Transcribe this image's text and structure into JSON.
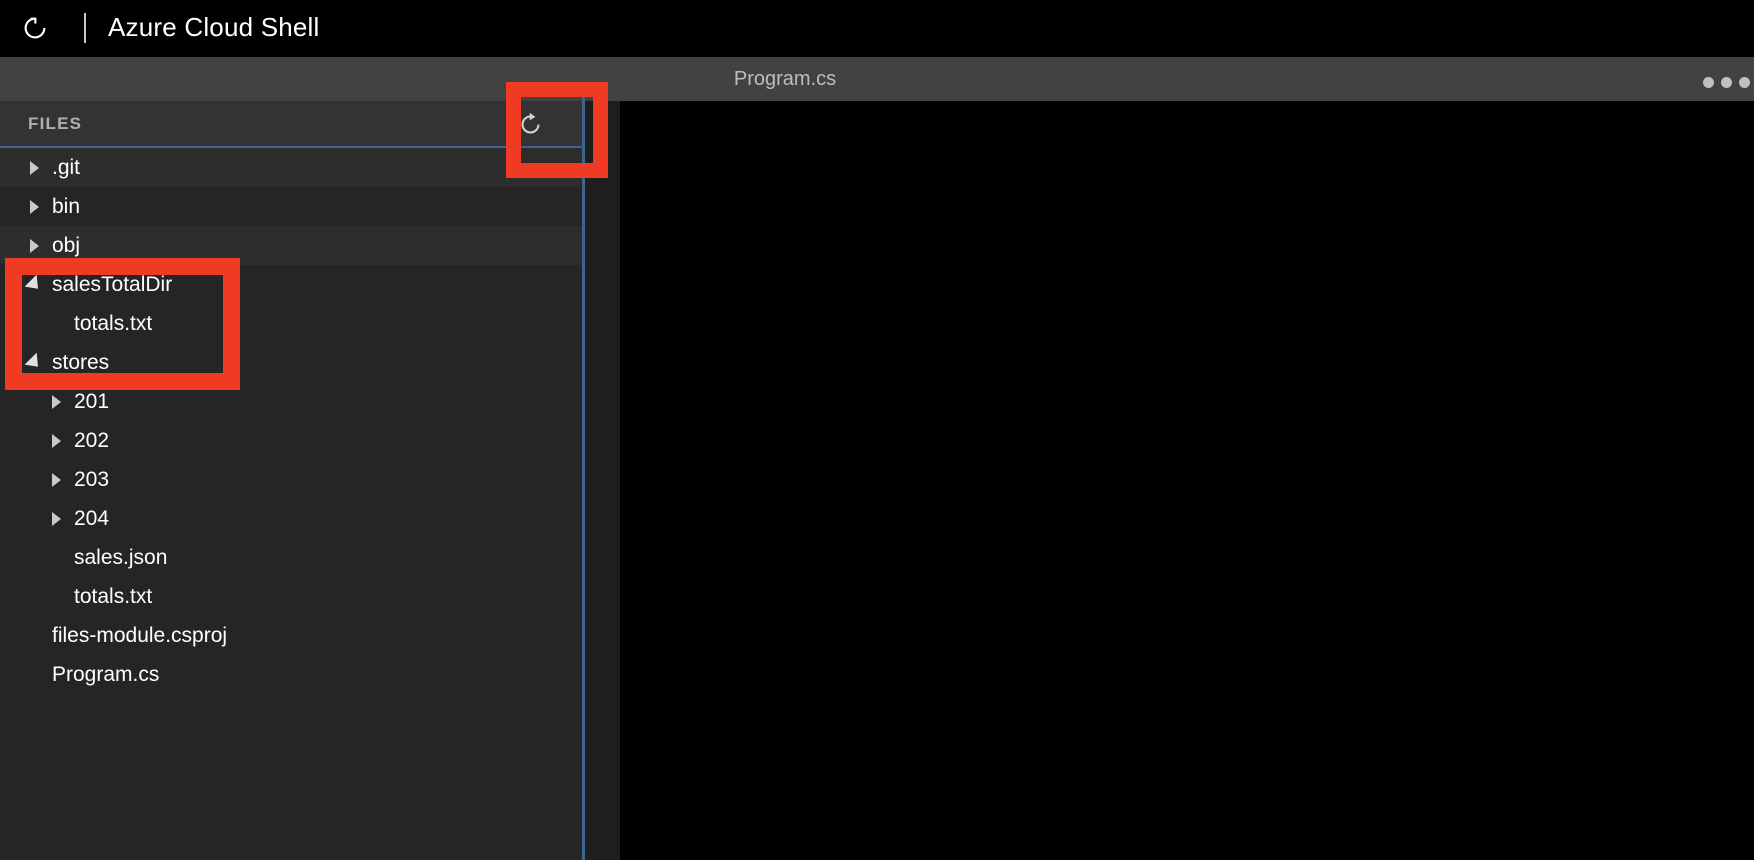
{
  "titlebar": {
    "restart_icon": "restart-circular-arrow-icon",
    "title": "Azure Cloud Shell",
    "separator": "|"
  },
  "editor": {
    "tab_label": "Program.cs",
    "overflow_menu": "ellipsis-icon",
    "content": ""
  },
  "file_panel": {
    "header_label": "FILES",
    "refresh_icon": "refresh-icon",
    "tree": [
      {
        "label": ".git",
        "level": 0,
        "type": "folder",
        "state": "collapsed",
        "shade": "alt"
      },
      {
        "label": "bin",
        "level": 0,
        "type": "folder",
        "state": "collapsed",
        "shade": "plain"
      },
      {
        "label": "obj",
        "level": 0,
        "type": "folder",
        "state": "collapsed",
        "shade": "alt"
      },
      {
        "label": "salesTotalDir",
        "level": 0,
        "type": "folder",
        "state": "expanded",
        "shade": "plain"
      },
      {
        "label": "totals.txt",
        "level": 1,
        "type": "file",
        "state": "none",
        "shade": "plain"
      },
      {
        "label": "stores",
        "level": 0,
        "type": "folder",
        "state": "expanded",
        "shade": "plain"
      },
      {
        "label": "201",
        "level": 1,
        "type": "folder",
        "state": "collapsed",
        "shade": "plain"
      },
      {
        "label": "202",
        "level": 1,
        "type": "folder",
        "state": "collapsed",
        "shade": "plain"
      },
      {
        "label": "203",
        "level": 1,
        "type": "folder",
        "state": "collapsed",
        "shade": "plain"
      },
      {
        "label": "204",
        "level": 1,
        "type": "folder",
        "state": "collapsed",
        "shade": "plain"
      },
      {
        "label": "sales.json",
        "level": 1,
        "type": "file",
        "state": "none",
        "shade": "plain"
      },
      {
        "label": "totals.txt",
        "level": 1,
        "type": "file",
        "state": "none",
        "shade": "plain"
      },
      {
        "label": "files-module.csproj",
        "level": 0,
        "type": "file",
        "state": "none",
        "shade": "plain"
      },
      {
        "label": "Program.cs",
        "level": 0,
        "type": "file",
        "state": "none",
        "shade": "plain"
      }
    ]
  },
  "annotations": [
    {
      "name": "refresh-button-highlight",
      "color": "#ef3b23"
    },
    {
      "name": "salestotaldir-highlight",
      "color": "#ef3b23"
    }
  ],
  "colors": {
    "annotation_red": "#ef3b23",
    "divider_blue": "#3b6491",
    "panel_bg": "#252526",
    "chrome_bg": "#424242",
    "editor_bg": "#000000"
  }
}
